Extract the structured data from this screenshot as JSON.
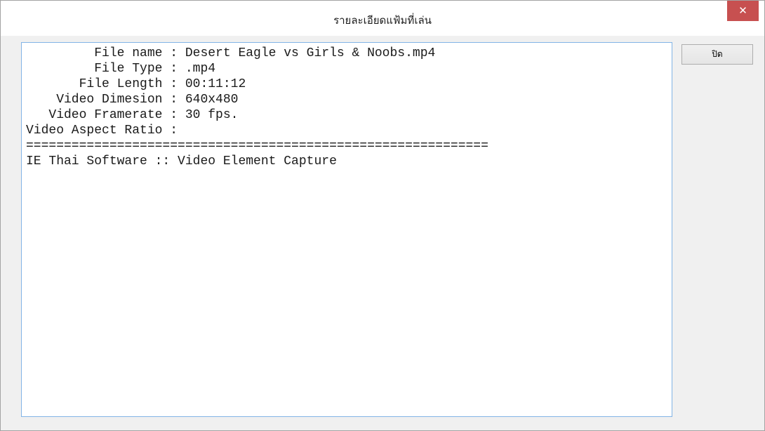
{
  "window": {
    "title": "รายละเอียดแฟ้มที่เล่น",
    "close_glyph": "✕"
  },
  "info_text": "         File name : Desert Eagle vs Girls & Noobs.mp4\n         File Type : .mp4\n       File Length : 00:11:12\n    Video Dimesion : 640x480\n   Video Framerate : 30 fps.\nVideo Aspect Ratio : \n=============================================================\nIE Thai Software :: Video Element Capture",
  "buttons": {
    "close_label": "ปิด"
  },
  "colors": {
    "close_button_bg": "#c75050",
    "info_box_border": "#82b4e6"
  }
}
